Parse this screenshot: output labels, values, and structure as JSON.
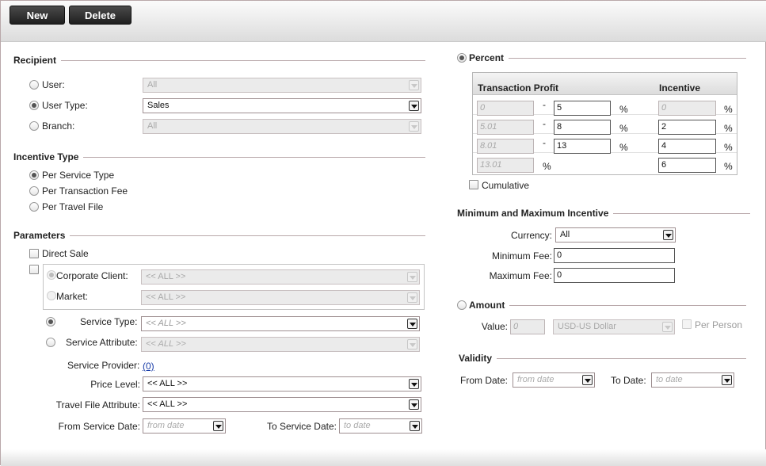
{
  "toolbar": {
    "new_label": "New",
    "delete_label": "Delete"
  },
  "recipient": {
    "title": "Recipient",
    "user_label": "User:",
    "user_value": "All",
    "user_type_label": "User Type:",
    "user_type_value": "Sales",
    "branch_label": "Branch:",
    "branch_value": "All"
  },
  "incentive_type": {
    "title": "Incentive Type",
    "options": [
      "Per Service Type",
      "Per Transaction Fee",
      "Per Travel File"
    ],
    "selected": "Per Service Type"
  },
  "parameters": {
    "title": "Parameters",
    "direct_sale_label": "Direct Sale",
    "corporate_client_label": "Corporate Client:",
    "corporate_client_value": "<< ALL >>",
    "market_label": "Market:",
    "market_value": "<< ALL >>",
    "service_type_label": "Service Type:",
    "service_type_value": "<< ALL >>",
    "service_attribute_label": "Service Attribute:",
    "service_attribute_value": "<< ALL >>",
    "service_provider_label": "Service Provider:",
    "service_provider_link": "(0)",
    "price_level_label": "Price Level:",
    "price_level_value": "<< ALL >>",
    "travel_file_attribute_label": "Travel File Attribute:",
    "travel_file_attribute_value": "<< ALL >>",
    "from_service_date_label": "From Service Date:",
    "from_service_date_placeholder": "from date",
    "to_service_date_label": "To Service Date:",
    "to_service_date_placeholder": "to date"
  },
  "percent": {
    "title": "Percent",
    "col_transaction_profit": "Transaction Profit",
    "col_incentive": "Incentive",
    "dash": "-",
    "pct": "%",
    "rows": [
      {
        "from": "0",
        "to": "5",
        "incentive": "0"
      },
      {
        "from": "5.01",
        "to": "8",
        "incentive": "2"
      },
      {
        "from": "8.01",
        "to": "13",
        "incentive": "4"
      },
      {
        "from": "13.01",
        "to": "",
        "incentive": "6"
      }
    ],
    "cumulative_label": "Cumulative"
  },
  "minmax": {
    "title": "Minimum and Maximum Incentive",
    "currency_label": "Currency:",
    "currency_value": "All",
    "min_fee_label": "Minimum Fee:",
    "min_fee_value": "0",
    "max_fee_label": "Maximum Fee:",
    "max_fee_value": "0"
  },
  "amount": {
    "title": "Amount",
    "value_label": "Value:",
    "value_value": "0",
    "currency_value": "USD-US Dollar",
    "per_person_label": "Per Person"
  },
  "validity": {
    "title": "Validity",
    "from_date_label": "From Date:",
    "from_date_placeholder": "from date",
    "to_date_label": "To Date:",
    "to_date_placeholder": "to date"
  }
}
